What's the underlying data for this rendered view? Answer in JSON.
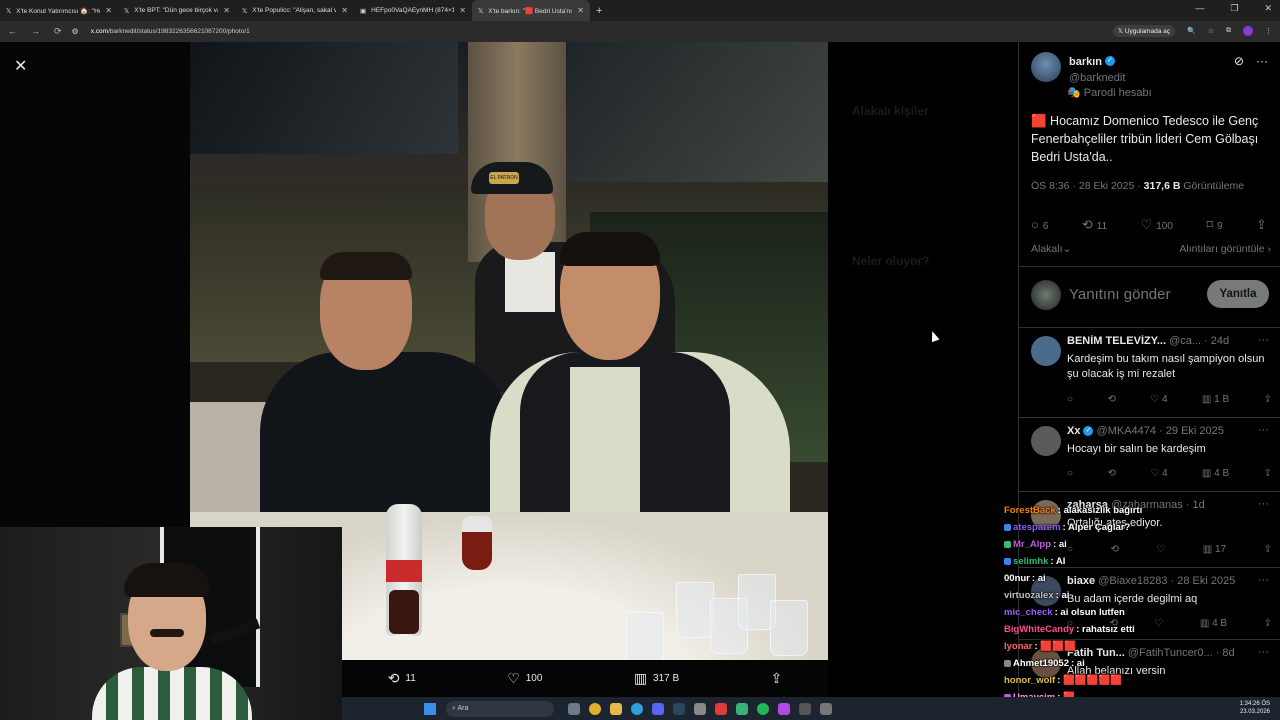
{
  "browser": {
    "tabs": [
      {
        "title": "X'te Konut Yatırımcısı 🏠: \"Hem"
      },
      {
        "title": "X'te BPT: \"Dün gece birçok vat"
      },
      {
        "title": "X'te Populicc: \"Alişan, sakal ve l"
      },
      {
        "title": "HEFpo0VaQAEynMH (874×1092)"
      },
      {
        "title": "X'te barkın: \"🟥 Bedri Usta'nın"
      }
    ],
    "url_host": "x.com",
    "url_path": "/barknedit/status/1983226356621087200/photo/1",
    "app_pill": "Uygulamada aç"
  },
  "media_actions": {
    "retweets": "11",
    "likes": "100",
    "views": "317 B"
  },
  "tweet": {
    "name": "barkın",
    "handle": "@barknedit",
    "parody_label": "Parodi hesabı",
    "text": "🟥 Hocamız Domenico Tedesco ile Genç Fenerbahçeliler tribün lideri Cem Gölbaşı Bedri Usta'da..",
    "time": "ÖS 8:36 · 28 Eki 2025 · ",
    "views_count": "317,6 B",
    "views_label": " Görüntüleme",
    "replies": "6",
    "retweets": "11",
    "likes": "100",
    "bookmarks": "9",
    "relevant_label": "Alakalı",
    "quotes_label": "Alıntıları görüntüle"
  },
  "reply_box": {
    "placeholder": "Yanıtını gönder",
    "button": "Yanıtla"
  },
  "replies": [
    {
      "name": "BENİM TELEVİZY...",
      "meta": " @ca... · 24d",
      "text": "Kardeşim bu takım nasıl şampiyon olsun şu olacak iş mi rezalet",
      "retweets": "",
      "likes": "4",
      "views": "1 B",
      "avatar_color": "#4a6b8a"
    },
    {
      "name": "Xx",
      "meta": " @MKA4474 · 29 Eki 2025",
      "text": "Hocayı bir salın be kardeşim",
      "retweets": "",
      "likes": "4",
      "views": "4 B",
      "avatar_color": "#5a5a5a"
    },
    {
      "name": "zaharsa",
      "meta": " @zaharmanas · 1d",
      "text": "Ortalığı ateş ediyor.",
      "retweets": "",
      "likes": "",
      "views": "17",
      "avatar_color": "#7a6a5a"
    },
    {
      "name": "biaxe",
      "meta": " @Biaxe18283 · 28 Eki 2025",
      "text": "Bu adam içerde degilmi aq",
      "retweets": "",
      "likes": "",
      "views": "4 B",
      "avatar_color": "#3d4a5d"
    },
    {
      "name": "Fatih Tun...",
      "meta": " @FatihTuncer0... · 8d",
      "text": "Allah belanızı versin",
      "retweets": "",
      "likes": "",
      "views": "",
      "avatar_color": "#6a5040"
    }
  ],
  "ghost_sidebar": {
    "title1": "Alakalı kişiler",
    "title2": "Neler oluyor?"
  },
  "chat": [
    {
      "user": "ForestBack",
      "msg": "alakasızlık bağırtı",
      "color": "#ff7f00"
    },
    {
      "user": "atesparem",
      "msg": "Alper Çağlar?",
      "color": "#8a5cf6"
    },
    {
      "user": "Mr_Alpp",
      "msg": "ai",
      "color": "#c05ae0"
    },
    {
      "user": "selimhk",
      "msg": "AI",
      "color": "#2fbf71"
    },
    {
      "user": "00nur",
      "msg": "ai",
      "color": "#ffffff"
    },
    {
      "user": "virtuozalex",
      "msg": "ai",
      "color": "#bfbfbf"
    },
    {
      "user": "mic_check",
      "msg": "ai olsun lutfen",
      "color": "#9b59ff"
    },
    {
      "user": "BigWhiteCandy",
      "msg": "rahatsız etti",
      "color": "#ff4d8d"
    },
    {
      "user": "lyonar",
      "msg": "🟥🟥🟥",
      "color": "#ff6a6a"
    },
    {
      "user": "Ahmet19052",
      "msg": "ai",
      "color": "#ffffff"
    },
    {
      "user": "honor_wolf",
      "msg": "🟥🟥🟥🟥🟥",
      "color": "#e0c040"
    },
    {
      "user": "Umaycim",
      "msg": "🟥",
      "color": "#ff9ad5"
    }
  ],
  "taskbar": {
    "search_label": "Ara",
    "time": "1:34:26 ÖS",
    "date": "23.03.2026"
  }
}
